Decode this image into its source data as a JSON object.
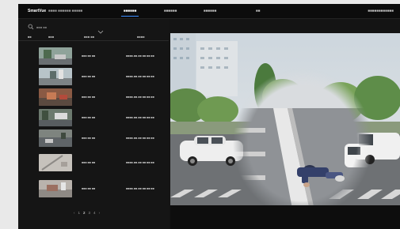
{
  "header": {
    "brand": "SmartVue",
    "brand_sub": "■■■■ ■■■■■■ ■■■■■",
    "nav": [
      "■■■■■■",
      "■■■■■■",
      "■■■■■■",
      "■■"
    ],
    "user": "■■■■■■■■■■■■"
  },
  "search": {
    "placeholder": "■■■ ■■",
    "icon": "search-icon"
  },
  "list": {
    "columns": [
      "■■",
      "■■■",
      "■■■ ■■",
      "■■■■"
    ],
    "rows": [
      {
        "no": "",
        "camera": "■■■ ■■ ■■",
        "time": "■■■■-■■-■■ ■■:■■:■■"
      },
      {
        "no": "",
        "camera": "■■■ ■■ ■■",
        "time": "■■■■-■■-■■ ■■:■■:■■"
      },
      {
        "no": "",
        "camera": "■■■ ■■ ■■",
        "time": "■■■■-■■-■■ ■■:■■:■■"
      },
      {
        "no": "",
        "camera": "■■■ ■■ ■■",
        "time": "■■■■-■■-■■ ■■:■■:■■"
      },
      {
        "no": "",
        "camera": "■■■ ■■ ■■",
        "time": "■■■■-■■-■■ ■■:■■:■■"
      },
      {
        "no": "",
        "camera": "■■■ ■■ ■■",
        "time": "■■■■-■■-■■ ■■:■■:■■"
      },
      {
        "no": "",
        "camera": "■■■ ■■ ■■",
        "time": "■■■■-■■-■■ ■■:■■:■■"
      }
    ],
    "pagination": [
      "‹",
      "1",
      "2",
      "3",
      "4",
      "›"
    ],
    "current_page": "2"
  },
  "colors": {
    "accent": "#3b8dff",
    "panel": "#151515",
    "topbar": "#0c0c0c"
  }
}
